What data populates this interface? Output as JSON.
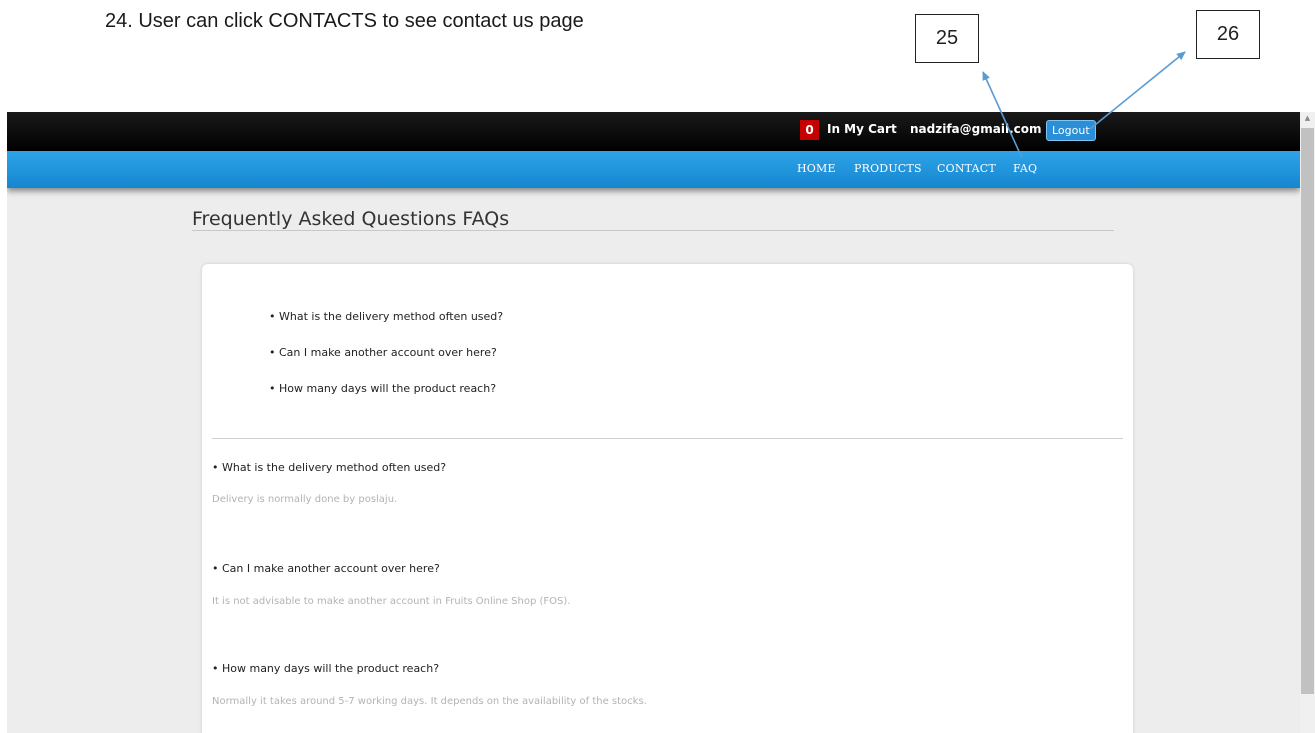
{
  "document": {
    "caption": "24. User can click CONTACTS to see contact us page",
    "callouts": [
      "25",
      "26"
    ]
  },
  "topbar": {
    "cart_count": "0",
    "cart_label": "In My Cart",
    "user_email": "nadzifa@gmail.com",
    "logout_label": "Logout"
  },
  "nav": {
    "items": [
      "HOME",
      "PRODUCTS",
      "CONTACT",
      "FAQ"
    ]
  },
  "page": {
    "title": "Frequently Asked Questions FAQs"
  },
  "faq": {
    "toc": [
      "• What is the delivery method often used?",
      "• Can I make another account over here?",
      "• How many days will the product reach?"
    ],
    "entries": [
      {
        "question": "• What is the delivery method often used?",
        "answer": "Delivery is normally done by poslaju."
      },
      {
        "question": "• Can I make another account over here?",
        "answer": "It is not advisable to make another account in Fruits Online Shop (FOS)."
      },
      {
        "question": "• How many days will the product reach?",
        "answer": "Normally it takes around 5-7 working days. It depends on the availability of the stocks."
      }
    ]
  },
  "colors": {
    "topbar": "#000000",
    "navbar": "#1a95dc",
    "cart_badge": "#c40000",
    "logout_button": "#2a8fd6",
    "answer_text": "#b3b3b3",
    "arrow": "#5b9bd5"
  },
  "icons": {
    "scroll_up": "scroll-up-arrow-icon"
  }
}
